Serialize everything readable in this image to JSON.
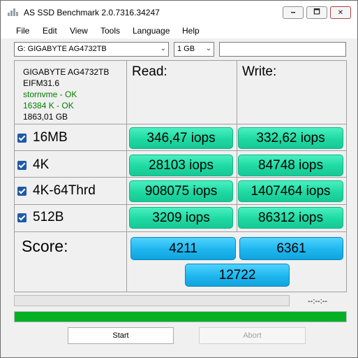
{
  "window": {
    "title": "AS SSD Benchmark 2.0.7316.34247",
    "controls": {
      "minimize": "🗕",
      "maximize": "🗖",
      "close": "✕"
    }
  },
  "menu": [
    "File",
    "Edit",
    "View",
    "Tools",
    "Language",
    "Help"
  ],
  "toolbar": {
    "drive": "G: GIGABYTE AG4732TB",
    "size": "1 GB",
    "extra_input": ""
  },
  "drive_info": {
    "model": "GIGABYTE AG4732TB",
    "firmware": "EIFM31.6",
    "driver_status": "stornvme - OK",
    "alignment_status": "16384 K - OK",
    "capacity": "1863,01 GB"
  },
  "columns": {
    "read": "Read:",
    "write": "Write:"
  },
  "tests": [
    {
      "label": "16MB",
      "checked": true,
      "read": "346,47 iops",
      "write": "332,62 iops"
    },
    {
      "label": "4K",
      "checked": true,
      "read": "28103 iops",
      "write": "84748 iops"
    },
    {
      "label": "4K-64Thrd",
      "checked": true,
      "read": "908075 iops",
      "write": "1407464 iops"
    },
    {
      "label": "512B",
      "checked": true,
      "read": "3209 iops",
      "write": "86312 iops"
    }
  ],
  "score": {
    "label": "Score:",
    "read": "4211",
    "write": "6361",
    "total": "12722"
  },
  "progress": {
    "current_percent": 0,
    "overall_percent": 100,
    "timer": "--:--:--"
  },
  "buttons": {
    "start": "Start",
    "abort": "Abort"
  },
  "colors": {
    "result_green": "#1ed9a2",
    "score_blue": "#1eb6ee",
    "progress_green": "#06b025",
    "ok_green": "#008000"
  }
}
